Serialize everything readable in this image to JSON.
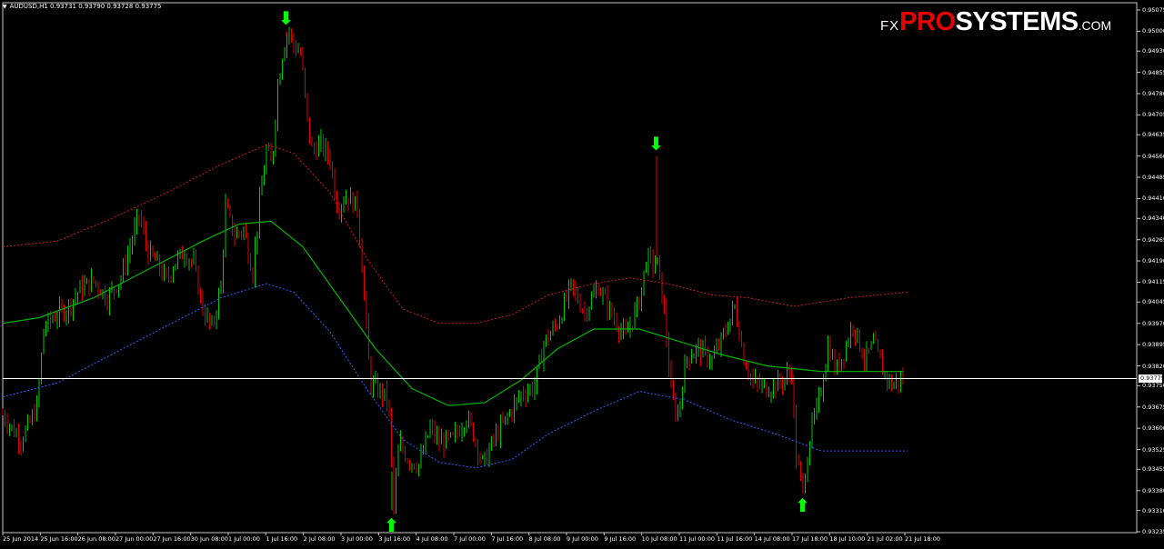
{
  "header": {
    "symbol_info": "AUDUSD,H1  0.93731 0.93790 0.93728 0.93775"
  },
  "logo": {
    "fx": "FX",
    "pro": "PRO",
    "systems": "SYSTEMS",
    "com": ".COM"
  },
  "colors": {
    "background": "#000000",
    "bull_candle": "#00c800",
    "bear_candle": "#e00000",
    "middle_band": "#00b400",
    "upper_band": "#c81e1e",
    "lower_band": "#2864ff",
    "current_price_line": "#ffffff",
    "signal_arrow": "#00ff00"
  },
  "current_price": "0.93775",
  "chart_data": {
    "type": "line",
    "instrument": "AUDUSD",
    "timeframe": "H1",
    "ylim": [
      0.93235,
      0.95075
    ],
    "ytick_labels": [
      "0.95075",
      "0.95000",
      "0.94930",
      "0.94855",
      "0.94780",
      "0.94705",
      "0.94635",
      "0.94560",
      "0.94485",
      "0.94410",
      "0.94340",
      "0.94265",
      "0.94190",
      "0.94115",
      "0.94045",
      "0.93970",
      "0.93895",
      "0.93820",
      "0.93750",
      "0.93675",
      "0.93600",
      "0.93525",
      "0.93455",
      "0.93380",
      "0.93310",
      "0.93235"
    ],
    "xtick_labels": [
      "25 Jun 2014",
      "25 Jun 16:00",
      "26 Jun 08:00",
      "27 Jun 00:00",
      "27 Jun 16:00",
      "30 Jun 08:00",
      "1 Jul 00:00",
      "1 Jul 16:00",
      "2 Jul 08:00",
      "3 Jul 00:00",
      "3 Jul 16:00",
      "4 Jul 08:00",
      "7 Jul 00:00",
      "7 Jul 16:00",
      "8 Jul 08:00",
      "9 Jul 00:00",
      "9 Jul 16:00",
      "10 Jul 08:00",
      "11 Jul 00:00",
      "11 Jul 16:00",
      "14 Jul 08:00",
      "17 Jul 18:00",
      "18 Jul 10:00",
      "21 Jul 02:00",
      "21 Jul 18:00"
    ],
    "price_path": [
      [
        0,
        0.9365
      ],
      [
        10,
        0.936
      ],
      [
        20,
        0.9356
      ],
      [
        30,
        0.9362
      ],
      [
        38,
        0.9368
      ],
      [
        45,
        0.9395
      ],
      [
        55,
        0.9399
      ],
      [
        70,
        0.9402
      ],
      [
        85,
        0.9409
      ],
      [
        100,
        0.9412
      ],
      [
        115,
        0.9406
      ],
      [
        130,
        0.9413
      ],
      [
        140,
        0.9424
      ],
      [
        150,
        0.9435
      ],
      [
        160,
        0.9422
      ],
      [
        170,
        0.9418
      ],
      [
        180,
        0.9412
      ],
      [
        190,
        0.9419
      ],
      [
        200,
        0.9422
      ],
      [
        210,
        0.9418
      ],
      [
        220,
        0.9402
      ],
      [
        230,
        0.9395
      ],
      [
        240,
        0.941
      ],
      [
        245,
        0.9438
      ],
      [
        255,
        0.9428
      ],
      [
        265,
        0.943
      ],
      [
        275,
        0.9415
      ],
      [
        282,
        0.9438
      ],
      [
        290,
        0.9458
      ],
      [
        296,
        0.9452
      ],
      [
        302,
        0.948
      ],
      [
        308,
        0.9493
      ],
      [
        314,
        0.9501
      ],
      [
        320,
        0.9495
      ],
      [
        328,
        0.9492
      ],
      [
        335,
        0.9468
      ],
      [
        340,
        0.9458
      ],
      [
        350,
        0.946
      ],
      [
        360,
        0.9455
      ],
      [
        368,
        0.9438
      ],
      [
        378,
        0.9442
      ],
      [
        390,
        0.9438
      ],
      [
        398,
        0.9405
      ],
      [
        404,
        0.9376
      ],
      [
        415,
        0.9373
      ],
      [
        424,
        0.937
      ],
      [
        430,
        0.9332
      ],
      [
        436,
        0.9355
      ],
      [
        446,
        0.9349
      ],
      [
        458,
        0.9347
      ],
      [
        470,
        0.936
      ],
      [
        480,
        0.9355
      ],
      [
        495,
        0.9356
      ],
      [
        510,
        0.9364
      ],
      [
        520,
        0.9356
      ],
      [
        528,
        0.9347
      ],
      [
        540,
        0.9356
      ],
      [
        555,
        0.9364
      ],
      [
        570,
        0.9372
      ],
      [
        585,
        0.9375
      ],
      [
        595,
        0.939
      ],
      [
        610,
        0.9397
      ],
      [
        625,
        0.941
      ],
      [
        640,
        0.9401
      ],
      [
        655,
        0.941
      ],
      [
        670,
        0.94
      ],
      [
        685,
        0.9392
      ],
      [
        700,
        0.9405
      ],
      [
        708,
        0.942
      ],
      [
        715,
        0.9418
      ],
      [
        720,
        0.9418
      ],
      [
        728,
        0.94
      ],
      [
        735,
        0.9372
      ],
      [
        742,
        0.9364
      ],
      [
        752,
        0.9385
      ],
      [
        765,
        0.9388
      ],
      [
        780,
        0.9384
      ],
      [
        792,
        0.9392
      ],
      [
        805,
        0.9403
      ],
      [
        815,
        0.9385
      ],
      [
        825,
        0.9376
      ],
      [
        840,
        0.9374
      ],
      [
        855,
        0.9376
      ],
      [
        868,
        0.938
      ],
      [
        872,
        0.935
      ],
      [
        880,
        0.9338
      ],
      [
        888,
        0.9358
      ],
      [
        898,
        0.937
      ],
      [
        908,
        0.939
      ],
      [
        916,
        0.938
      ],
      [
        925,
        0.9387
      ],
      [
        935,
        0.9397
      ],
      [
        948,
        0.9384
      ],
      [
        958,
        0.939
      ],
      [
        968,
        0.938
      ],
      [
        978,
        0.9375
      ],
      [
        990,
        0.93775
      ]
    ],
    "middle_band": [
      [
        0,
        0.9397
      ],
      [
        40,
        0.9399
      ],
      [
        100,
        0.9406
      ],
      [
        160,
        0.9416
      ],
      [
        220,
        0.9426
      ],
      [
        260,
        0.9432
      ],
      [
        295,
        0.9433
      ],
      [
        330,
        0.9424
      ],
      [
        370,
        0.9406
      ],
      [
        410,
        0.9388
      ],
      [
        450,
        0.9374
      ],
      [
        490,
        0.9368
      ],
      [
        530,
        0.9369
      ],
      [
        570,
        0.9377
      ],
      [
        610,
        0.9388
      ],
      [
        650,
        0.9395
      ],
      [
        700,
        0.9395
      ],
      [
        740,
        0.9391
      ],
      [
        790,
        0.9386
      ],
      [
        840,
        0.9382
      ],
      [
        900,
        0.938
      ],
      [
        990,
        0.938
      ]
    ],
    "upper_band": [
      [
        0,
        0.9424
      ],
      [
        60,
        0.9426
      ],
      [
        120,
        0.9434
      ],
      [
        180,
        0.9443
      ],
      [
        240,
        0.9453
      ],
      [
        290,
        0.946
      ],
      [
        320,
        0.9457
      ],
      [
        360,
        0.9443
      ],
      [
        400,
        0.942
      ],
      [
        440,
        0.9402
      ],
      [
        480,
        0.9397
      ],
      [
        520,
        0.9397
      ],
      [
        560,
        0.94
      ],
      [
        600,
        0.9407
      ],
      [
        650,
        0.9411
      ],
      [
        690,
        0.9413
      ],
      [
        730,
        0.9411
      ],
      [
        780,
        0.9407
      ],
      [
        820,
        0.9406
      ],
      [
        870,
        0.9403
      ],
      [
        930,
        0.9406
      ],
      [
        995,
        0.9408
      ]
    ],
    "lower_band": [
      [
        0,
        0.9371
      ],
      [
        60,
        0.9376
      ],
      [
        120,
        0.9386
      ],
      [
        180,
        0.9396
      ],
      [
        240,
        0.9406
      ],
      [
        290,
        0.9411
      ],
      [
        320,
        0.9408
      ],
      [
        360,
        0.9394
      ],
      [
        400,
        0.9374
      ],
      [
        440,
        0.9356
      ],
      [
        480,
        0.9348
      ],
      [
        520,
        0.9346
      ],
      [
        560,
        0.9349
      ],
      [
        600,
        0.9358
      ],
      [
        650,
        0.9366
      ],
      [
        700,
        0.9373
      ],
      [
        750,
        0.937
      ],
      [
        800,
        0.9363
      ],
      [
        850,
        0.9358
      ],
      [
        900,
        0.9352
      ],
      [
        995,
        0.9352
      ]
    ],
    "signal_arrows": [
      {
        "direction": "down",
        "x": 312,
        "price": 0.95
      },
      {
        "direction": "up",
        "x": 428,
        "price": 0.9331
      },
      {
        "direction": "down",
        "x": 719,
        "price": 0.9456
      },
      {
        "direction": "up",
        "x": 880,
        "price": 0.9338
      }
    ]
  }
}
